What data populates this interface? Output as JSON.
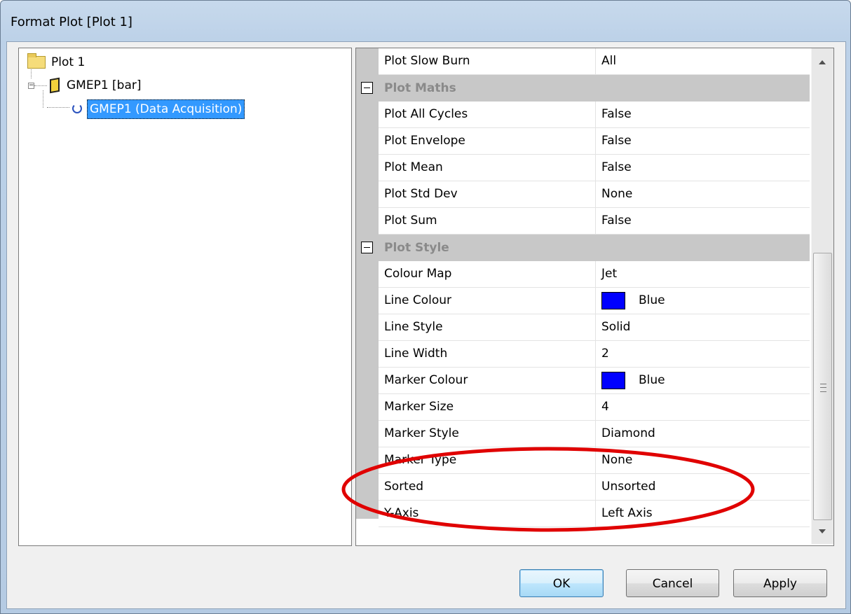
{
  "window": {
    "title": "Format Plot [Plot 1]"
  },
  "tree": {
    "root": {
      "label": "Plot 1",
      "icon": "folder-icon"
    },
    "child": {
      "label": "GMEP1 [bar]",
      "icon": "book-icon"
    },
    "leaf": {
      "label": "GMEP1 (Data Acquisition)",
      "icon": "refresh-icon",
      "selected": true
    }
  },
  "grid": {
    "top_row": {
      "name": "Plot Slow Burn",
      "value": "All"
    },
    "categories": [
      {
        "label": "Plot Maths",
        "rows": [
          {
            "name": "Plot All Cycles",
            "value": "False"
          },
          {
            "name": "Plot Envelope",
            "value": "False"
          },
          {
            "name": "Plot Mean",
            "value": "False"
          },
          {
            "name": "Plot Std Dev",
            "value": "None"
          },
          {
            "name": "Plot Sum",
            "value": "False"
          }
        ]
      },
      {
        "label": "Plot Style",
        "rows": [
          {
            "name": "Colour Map",
            "value": "Jet"
          },
          {
            "name": "Line Colour",
            "value": "Blue",
            "swatch": "#0000ff"
          },
          {
            "name": "Line Style",
            "value": "Solid"
          },
          {
            "name": "Line Width",
            "value": "2"
          },
          {
            "name": "Marker Colour",
            "value": "Blue",
            "swatch": "#0000ff"
          },
          {
            "name": "Marker Size",
            "value": "4"
          },
          {
            "name": "Marker Style",
            "value": "Diamond"
          },
          {
            "name": "Marker Type",
            "value": "None"
          },
          {
            "name": "Sorted",
            "value": "Unsorted"
          },
          {
            "name": "Y-Axis",
            "value": "Left Axis"
          }
        ]
      }
    ]
  },
  "buttons": {
    "ok": "OK",
    "cancel": "Cancel",
    "apply": "Apply"
  },
  "colors": {
    "annotation": "#e00000",
    "selection": "#3399ff",
    "category_bg": "#c8c8c8"
  }
}
